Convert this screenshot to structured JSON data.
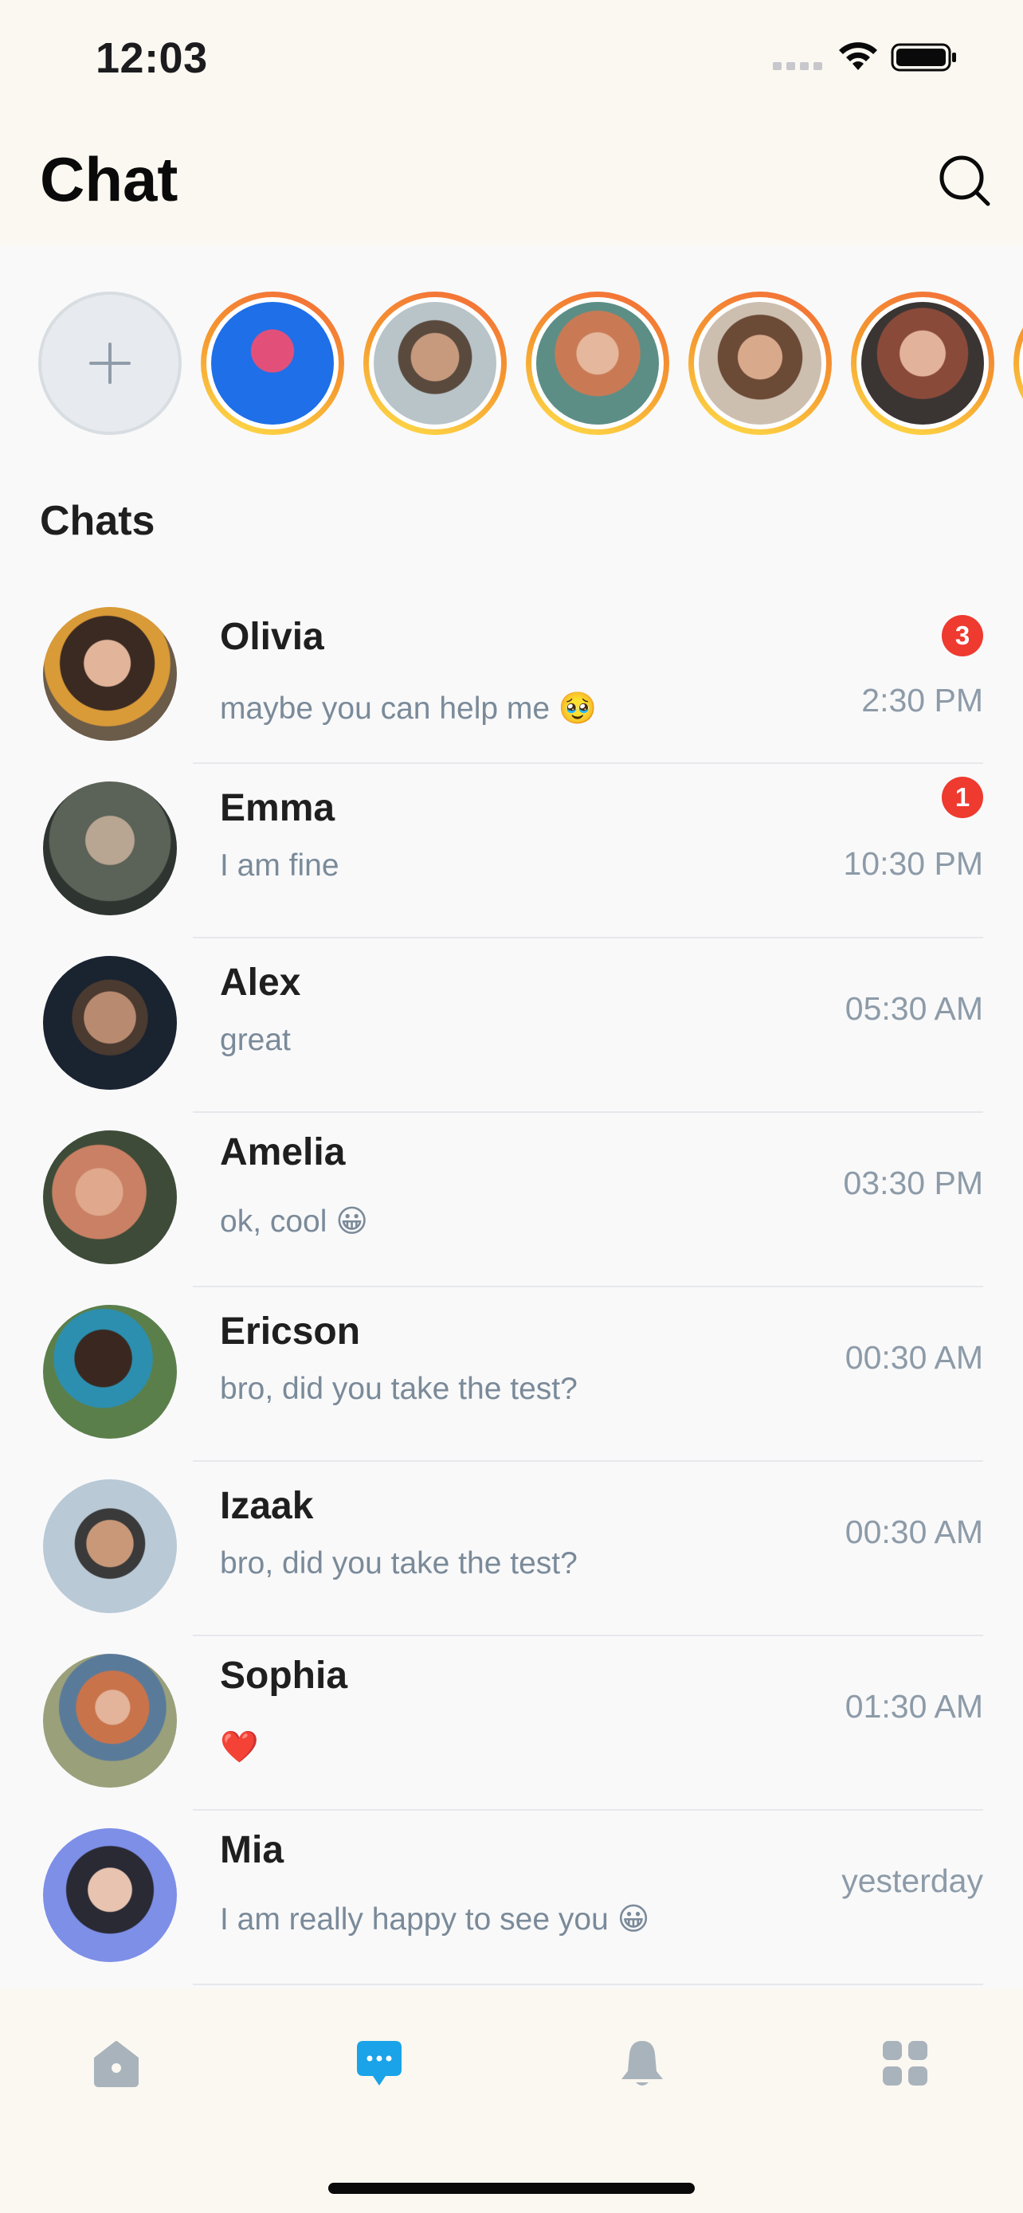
{
  "status_bar": {
    "time": "12:03"
  },
  "header": {
    "title": "Chat"
  },
  "stories": {
    "add_label": "+",
    "items": [
      {
        "colors": [
          "#1E6FE8",
          "#E2507A"
        ]
      },
      {
        "colors": [
          "#B9C4C9",
          "#5A4A3E"
        ]
      },
      {
        "colors": [
          "#5C8E86",
          "#C97A55"
        ]
      },
      {
        "colors": [
          "#CDBFB0",
          "#6B4A36"
        ]
      },
      {
        "colors": [
          "#3A3533",
          "#C78A6F"
        ]
      }
    ]
  },
  "section": {
    "title": "Chats"
  },
  "chats": [
    {
      "name": "Olivia",
      "message": "maybe you can help me 🥹",
      "time": "2:30 PM",
      "unread": "3",
      "avatar_colors": [
        "#6B5B49",
        "#D99A38"
      ]
    },
    {
      "name": "Emma",
      "message": "I am fine",
      "time": "10:30 PM",
      "unread": "1",
      "avatar_colors": [
        "#5B6257",
        "#2E3430"
      ]
    },
    {
      "name": "Alex",
      "message": "great",
      "time": "05:30 AM",
      "unread": "",
      "avatar_colors": [
        "#1A2330",
        "#B88A70"
      ]
    },
    {
      "name": "Amelia",
      "message": "ok, cool 😀",
      "time": "03:30 PM",
      "unread": "",
      "avatar_colors": [
        "#3E4B38",
        "#C98064"
      ]
    },
    {
      "name": "Ericson",
      "message": "bro, did you take the test?",
      "time": "00:30 AM",
      "unread": "",
      "avatar_colors": [
        "#5B7F4A",
        "#2C8FB0"
      ]
    },
    {
      "name": "Izaak",
      "message": "bro, did you take the test?",
      "time": "00:30 AM",
      "unread": "",
      "avatar_colors": [
        "#B9C9D6",
        "#3A3A3A"
      ]
    },
    {
      "name": "Sophia",
      "message": "❤️",
      "time": "01:30 AM",
      "unread": "",
      "avatar_colors": [
        "#9AA07A",
        "#C9734B"
      ]
    },
    {
      "name": "Mia",
      "message": "I am really happy to see you 😀",
      "time": "yesterday",
      "unread": "",
      "avatar_colors": [
        "#7E8FE8",
        "#2A2A35"
      ]
    }
  ],
  "nav": {
    "items": [
      {
        "icon": "home-icon",
        "active": false
      },
      {
        "icon": "chat-icon",
        "active": true
      },
      {
        "icon": "bell-icon",
        "active": false
      },
      {
        "icon": "grid-icon",
        "active": false
      }
    ],
    "active_color": "#1AA3E8",
    "inactive_color": "#A9B3BC"
  },
  "colors": {
    "header_bg": "#FBF8F1",
    "page_bg": "#F9F9FA",
    "badge": "#EE3A2F",
    "story_ring": [
      "#F26A3A",
      "#FFE04A"
    ]
  }
}
